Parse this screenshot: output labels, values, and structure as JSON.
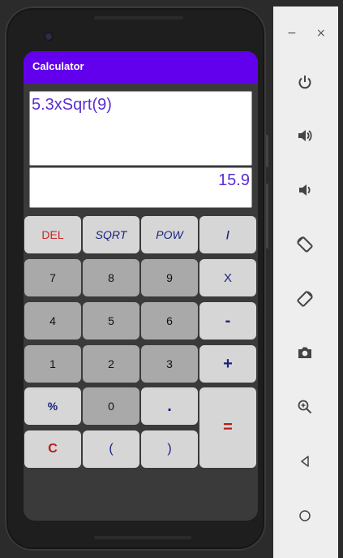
{
  "app": {
    "title": "Calculator",
    "accent_color": "#6200ee"
  },
  "display": {
    "expression": "5.3xSqrt(9)",
    "result": "15.9"
  },
  "keys": {
    "del": "DEL",
    "sqrt": "SQRT",
    "pow": "POW",
    "divide": "/",
    "seven": "7",
    "eight": "8",
    "nine": "9",
    "multiply": "X",
    "four": "4",
    "five": "5",
    "six": "6",
    "minus": "-",
    "one": "1",
    "two": "2",
    "three": "3",
    "plus": "+",
    "percent": "%",
    "zero": "0",
    "dot": ".",
    "equals": "=",
    "clear": "C",
    "open_paren": "(",
    "close_paren": ")"
  },
  "emulator_toolbar": {
    "minimize": "−",
    "close": "×",
    "icons": [
      "power-icon",
      "volume-up-icon",
      "volume-down-icon",
      "rotate-left-icon",
      "rotate-right-icon",
      "camera-icon",
      "zoom-icon",
      "back-icon",
      "home-icon"
    ]
  }
}
